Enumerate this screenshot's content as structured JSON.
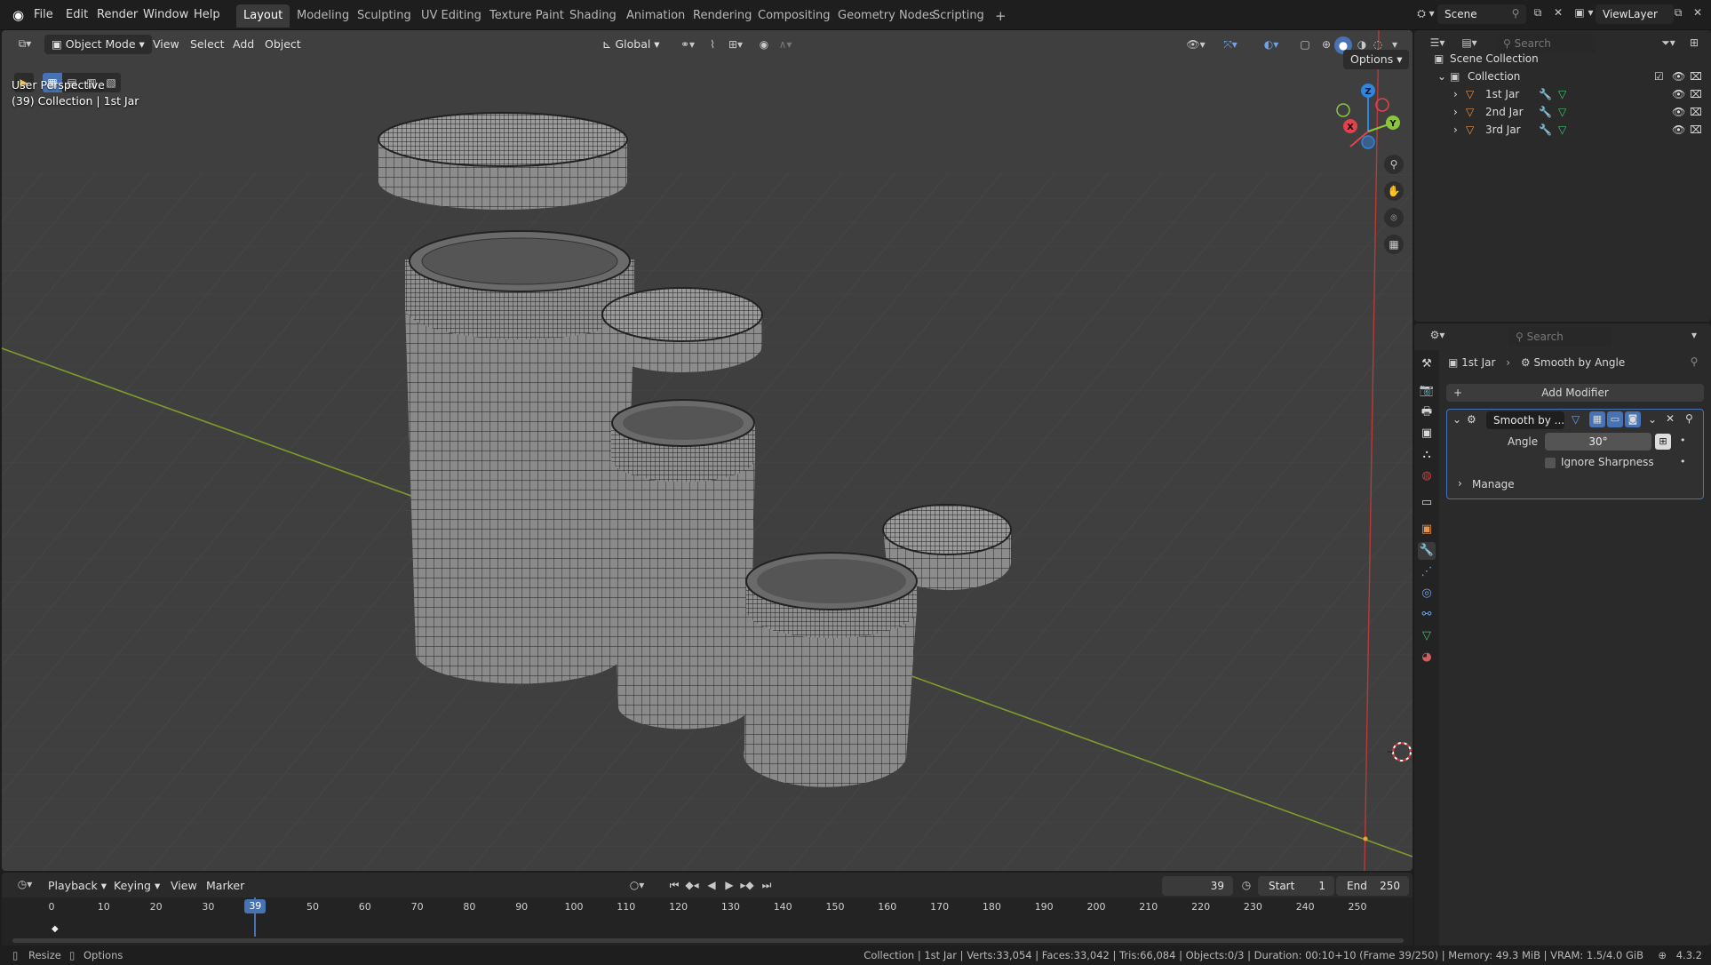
{
  "menu": {
    "items": [
      "File",
      "Edit",
      "Render",
      "Window",
      "Help"
    ],
    "workspaces": [
      "Layout",
      "Modeling",
      "Sculpting",
      "UV Editing",
      "Texture Paint",
      "Shading",
      "Animation",
      "Rendering",
      "Compositing",
      "Geometry Nodes",
      "Scripting"
    ],
    "active_workspace": "Layout",
    "add_tab": "+",
    "scene": "Scene",
    "view_layer": "ViewLayer"
  },
  "viewport": {
    "mode": "Object Mode",
    "menus": [
      "View",
      "Select",
      "Add",
      "Object"
    ],
    "transform_orientation": "Global",
    "options": "Options",
    "perspective_label": "User Perspective",
    "collection_label": "(39) Collection | 1st Jar",
    "gizmo_axes": {
      "x": "X",
      "y": "Y",
      "z": "Z"
    }
  },
  "outliner": {
    "search_placeholder": "Search",
    "scene_collection": "Scene Collection",
    "collection": "Collection",
    "objects": [
      "1st Jar",
      "2nd Jar",
      "3rd Jar"
    ]
  },
  "properties": {
    "search_placeholder": "Search",
    "breadcrumb_object": "1st Jar",
    "breadcrumb_modifier": "Smooth by Angle",
    "add_modifier": "Add Modifier",
    "modifier_name": "Smooth by ...",
    "angle_label": "Angle",
    "angle_value": "30°",
    "ignore_sharpness": "Ignore Sharpness",
    "ignore_sharpness_checked": false,
    "manage": "Manage"
  },
  "timeline": {
    "menus": [
      "Playback",
      "Keying",
      "View",
      "Marker"
    ],
    "current_frame": "39",
    "start_label": "Start",
    "start_value": "1",
    "end_label": "End",
    "end_value": "250",
    "ruler": [
      "0",
      "10",
      "20",
      "30",
      "39",
      "50",
      "60",
      "70",
      "80",
      "90",
      "100",
      "110",
      "120",
      "130",
      "140",
      "150",
      "160",
      "170",
      "180",
      "190",
      "200",
      "210",
      "220",
      "230",
      "240",
      "250"
    ]
  },
  "status": {
    "left_resize": "Resize",
    "left_options": "Options",
    "stats": "Collection | 1st Jar | Verts:33,054 | Faces:33,042 | Tris:66,084 | Objects:0/3 | Duration: 00:10+10 (Frame 39/250) | Memory: 49.3 MiB | VRAM: 1.5/4.0 GiB",
    "version": "4.3.2"
  },
  "colors": {
    "accent": "#4772b3",
    "viewport_bg": "#3f3f3f",
    "panel_bg": "#2a2a2a",
    "x_axis": "#e0434f",
    "y_axis": "#8bc53f",
    "z_axis": "#2e86de",
    "object_orange": "#e7914a"
  }
}
